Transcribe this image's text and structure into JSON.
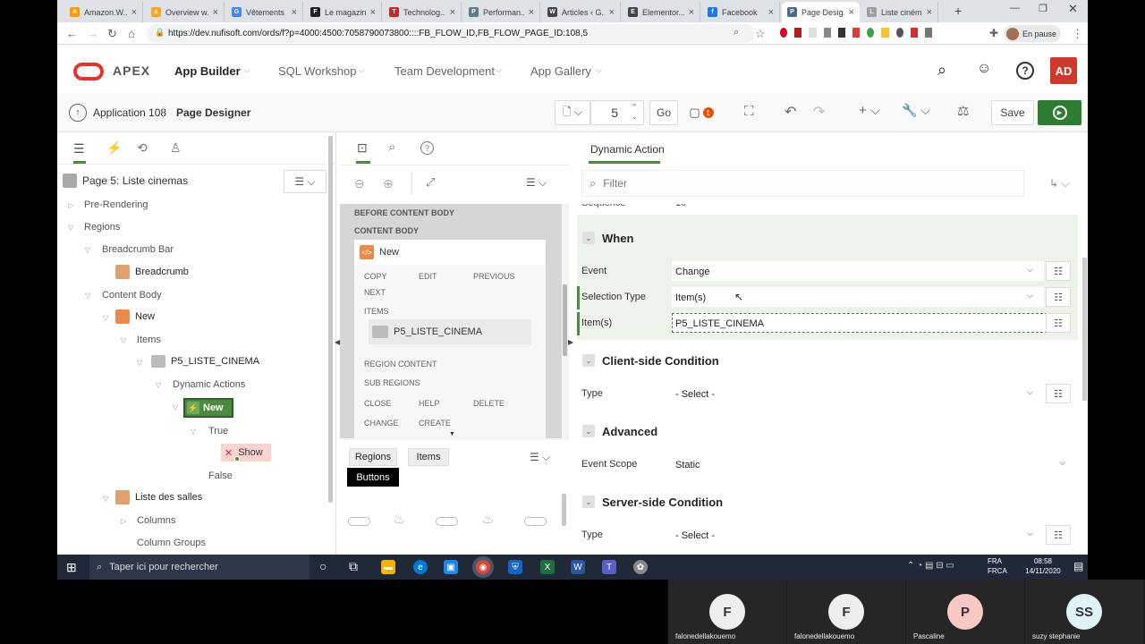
{
  "browser": {
    "tabs": [
      {
        "title": "Amazon.W...",
        "color": "#ff9900",
        "icon": "A"
      },
      {
        "title": "Overview w...",
        "color": "#f6a623",
        "icon": "a"
      },
      {
        "title": "Vêtements",
        "color": "#4285f4",
        "icon": "G"
      },
      {
        "title": "Le magazin...",
        "color": "#222222",
        "icon": "F"
      },
      {
        "title": "Technolog...",
        "color": "#c62828",
        "icon": "T"
      },
      {
        "title": "Performan...",
        "color": "#607d8b",
        "icon": "P"
      },
      {
        "title": "Articles ‹ G...",
        "color": "#444444",
        "icon": "W"
      },
      {
        "title": "Elementor...",
        "color": "#444444",
        "icon": "E"
      },
      {
        "title": "Facebook",
        "color": "#1877f2",
        "icon": "f"
      },
      {
        "title": "Page Desig...",
        "color": "#4a6b8a",
        "icon": "P",
        "active": true
      },
      {
        "title": "Liste ciném...",
        "color": "#9e9e9e",
        "icon": "L"
      }
    ],
    "url": "https://dev.nufisoft.com/ords/f?p=4000:4500:7058790073800::::FB_FLOW_ID,FB_FLOW_PAGE_ID:108,5",
    "pause_label": "En pause"
  },
  "apex": {
    "logo": "APEX",
    "menus": [
      "App Builder",
      "SQL Workshop",
      "Team Development",
      "App Gallery"
    ],
    "avatar": "AD"
  },
  "toolbar": {
    "app_label": "Application 108",
    "page_label": "Page Designer",
    "page_number": "5",
    "go_label": "Go",
    "badge_count": "1",
    "save_label": "Save"
  },
  "left": {
    "page_title": "Page 5: Liste cinemas",
    "tree": [
      {
        "label": "Pre-Rendering"
      },
      {
        "label": "Regions"
      },
      {
        "label": "Breadcrumb Bar"
      },
      {
        "label": "Breadcrumb"
      },
      {
        "label": "Content Body"
      },
      {
        "label": "New"
      },
      {
        "label": "Items"
      },
      {
        "label": "P5_LISTE_CINEMA"
      },
      {
        "label": "Dynamic Actions"
      },
      {
        "label": "New"
      },
      {
        "label": "True"
      },
      {
        "label": "Show"
      },
      {
        "label": "False"
      },
      {
        "label": "Liste des salles"
      },
      {
        "label": "Columns"
      },
      {
        "label": "Column Groups"
      }
    ]
  },
  "middle": {
    "before_content": "BEFORE CONTENT BODY",
    "content_body": "CONTENT BODY",
    "region_name": "New",
    "positions": [
      "COPY",
      "EDIT",
      "PREVIOUS",
      "NEXT",
      "ITEMS",
      "REGION CONTENT",
      "SUB REGIONS",
      "CLOSE",
      "HELP",
      "DELETE",
      "CHANGE",
      "CREATE"
    ],
    "item_name": "P5_LISTE_CINEMA",
    "gallery_tabs": [
      "Regions",
      "Items",
      "Buttons"
    ]
  },
  "right": {
    "tab_label": "Dynamic Action",
    "filter_placeholder": "Filter",
    "sections": {
      "when": "When",
      "client": "Client-side Condition",
      "advanced": "Advanced",
      "server": "Server-side Condition"
    },
    "props": {
      "event_label": "Event",
      "event_value": "Change",
      "seltype_label": "Selection Type",
      "seltype_value": "Item(s)",
      "items_label": "Item(s)",
      "items_value": "P5_LISTE_CINEMA",
      "client_type_label": "Type",
      "client_type_value": "- Select -",
      "scope_label": "Event Scope",
      "scope_value": "Static",
      "server_type_label": "Type",
      "server_type_value": "- Select -"
    }
  },
  "taskbar": {
    "search_placeholder": "Taper ici pour rechercher",
    "lang1": "FRA",
    "lang2": "FRCA",
    "time": "08:58",
    "date": "14/11/2020"
  },
  "participants": [
    {
      "initial": "F",
      "name": "falonedellakouemo",
      "color": "#eeeeee"
    },
    {
      "initial": "F",
      "name": "falonedellakouemo",
      "color": "#eeeeee"
    },
    {
      "initial": "P",
      "name": "Pascaline",
      "color": "#f8c9c4"
    },
    {
      "initial": "SS",
      "name": "suzy stephanie",
      "color": "#dff3f8"
    }
  ]
}
